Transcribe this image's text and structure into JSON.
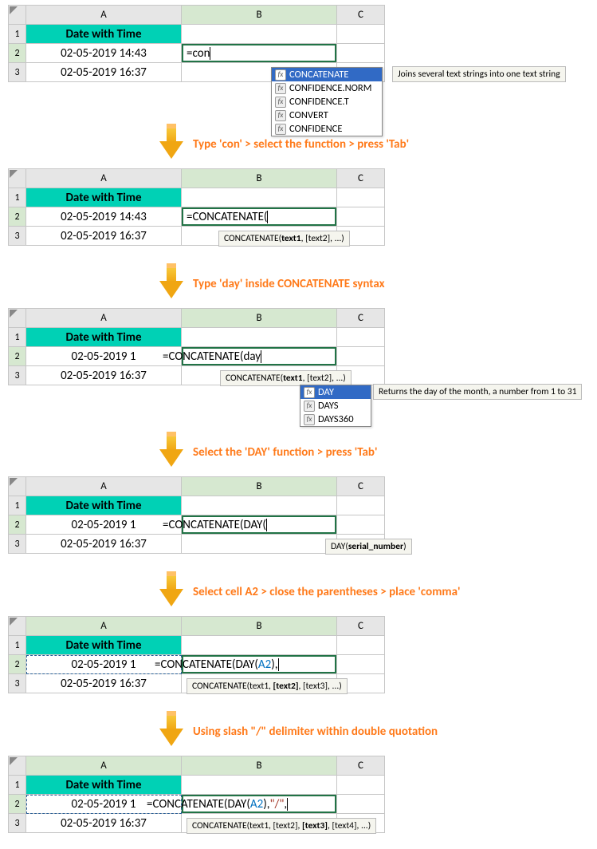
{
  "col_headers": {
    "A": "A",
    "B": "B",
    "C": "C"
  },
  "row_nums": {
    "r1": "1",
    "r2": "2",
    "r3": "3"
  },
  "header_label": "Date with Time",
  "cells": {
    "A2_full": "02-05-2019 14:43",
    "A3_full": "02-05-2019 16:37",
    "A2_trunc": "02-05-2019 1"
  },
  "step1": {
    "formula": "=con",
    "ac": {
      "i1": "CONCATENATE",
      "i2": "CONFIDENCE.NORM",
      "i3": "CONFIDENCE.T",
      "i4": "CONVERT",
      "i5": "CONFIDENCE"
    },
    "tip": "Joins several text strings into one text string"
  },
  "step2": {
    "caption": "Type 'con' > select the function > press 'Tab'",
    "formula": "=CONCATENATE(",
    "hint_pre": "CONCATENATE(",
    "hint_b": "text1",
    "hint_post": ", [text2], ...)"
  },
  "step3": {
    "caption": "Type 'day' inside CONCATENATE syntax",
    "formula": "=CONCATENATE(day",
    "hint_pre": "CONCATENATE(",
    "hint_b": "text1",
    "hint_post": ", [text2], ...)",
    "ac": {
      "i1": "DAY",
      "i2": "DAYS",
      "i3": "DAYS360"
    },
    "tip": "Returns the day of the month, a number from 1 to 31"
  },
  "step4": {
    "caption": "Select the 'DAY' function > press 'Tab'",
    "formula": "=CONCATENATE(DAY(",
    "hint_pre": "DAY(",
    "hint_b": "serial_number",
    "hint_post": ")"
  },
  "step5": {
    "caption": "Select cell A2 > close the parentheses > place 'comma'",
    "f_pre": "=CONCATENATE(DAY(",
    "f_ref": "A2",
    "f_post": "),",
    "hint_pre": "CONCATENATE(text1, ",
    "hint_b": "[text2]",
    "hint_post": ", [text3], ...)"
  },
  "step6": {
    "caption": "Using slash \"/\" delimiter within double quotation",
    "f_pre": "=CONCATENATE(DAY(",
    "f_ref": "A2",
    "f_mid": "),",
    "f_str": "\"/\"",
    "f_post": ",",
    "hint_pre": "CONCATENATE(text1, [text2], ",
    "hint_b": "[text3]",
    "hint_post": ", [text4], ...)"
  }
}
